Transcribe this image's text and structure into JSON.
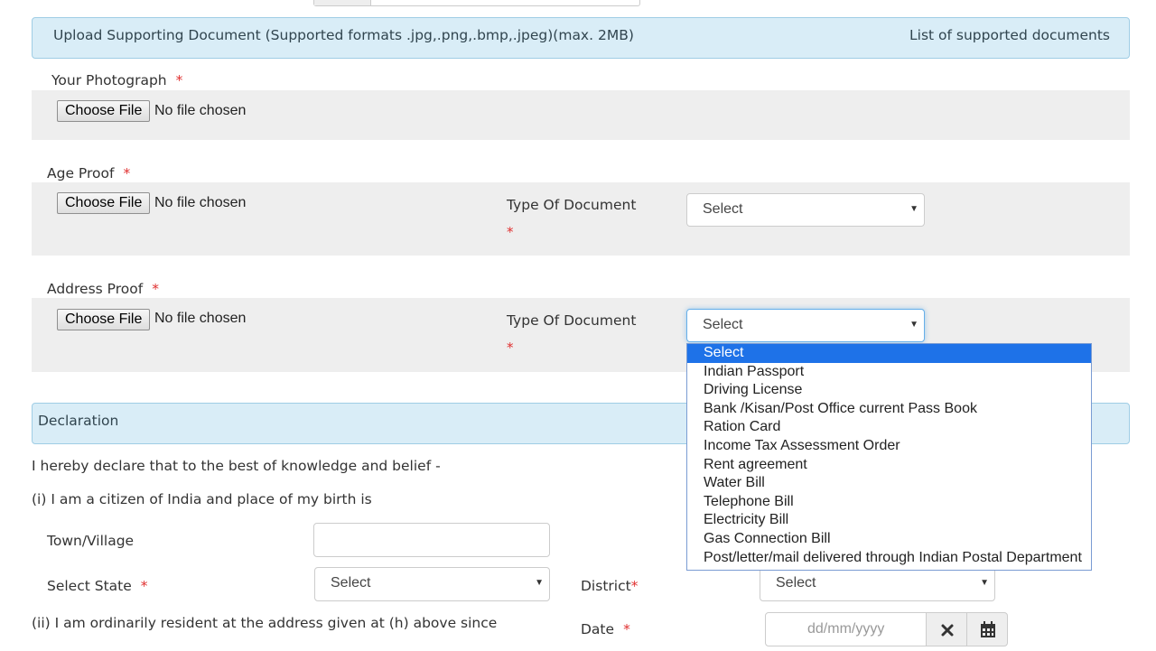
{
  "upload_panel": {
    "title": "Upload Supporting Document (Supported formats .jpg,.png,.bmp,.jpeg)(max. 2MB)",
    "link": "List of supported documents"
  },
  "required_mark": "*",
  "photo": {
    "label": "Your Photograph",
    "button": "Choose File",
    "status": "No file chosen"
  },
  "age_proof": {
    "label": "Age Proof",
    "button": "Choose File",
    "status": "No file chosen",
    "type_label": "Type Of Document",
    "select_value": "Select"
  },
  "address_proof": {
    "label": "Address Proof",
    "button": "Choose File",
    "status": "No file chosen",
    "type_label": "Type Of Document",
    "select_value": "Select",
    "options": [
      "Select",
      "Indian Passport",
      "Driving License",
      "Bank /Kisan/Post Office current Pass Book",
      "Ration Card",
      "Income Tax Assessment Order",
      "Rent agreement",
      "Water Bill",
      "Telephone Bill",
      "Electricity Bill",
      "Gas Connection Bill",
      "Post/letter/mail delivered through Indian Postal Department"
    ],
    "highlighted_option": "Select"
  },
  "declaration": {
    "title": "Declaration",
    "intro": "I hereby declare that to the best of knowledge and belief -",
    "citizen_line": "(i) I am a citizen of India and place of my birth is",
    "town_label": "Town/Village",
    "town_value": "",
    "state_label": "Select State",
    "state_value": "Select",
    "district_label": "District",
    "district_value": "Select",
    "resident_line": "(ii) I am ordinarily resident at the address given at (h) above since",
    "date_label": "Date",
    "date_placeholder": "dd/mm/yyyy"
  },
  "icons": {
    "clear": "close-icon",
    "calendar": "calendar-icon"
  },
  "colors": {
    "panel_bg": "#d9edf7",
    "panel_border": "#9fcde5",
    "required": "#e03030",
    "highlight": "#1e72e8",
    "gray_box": "#eeeeee"
  }
}
